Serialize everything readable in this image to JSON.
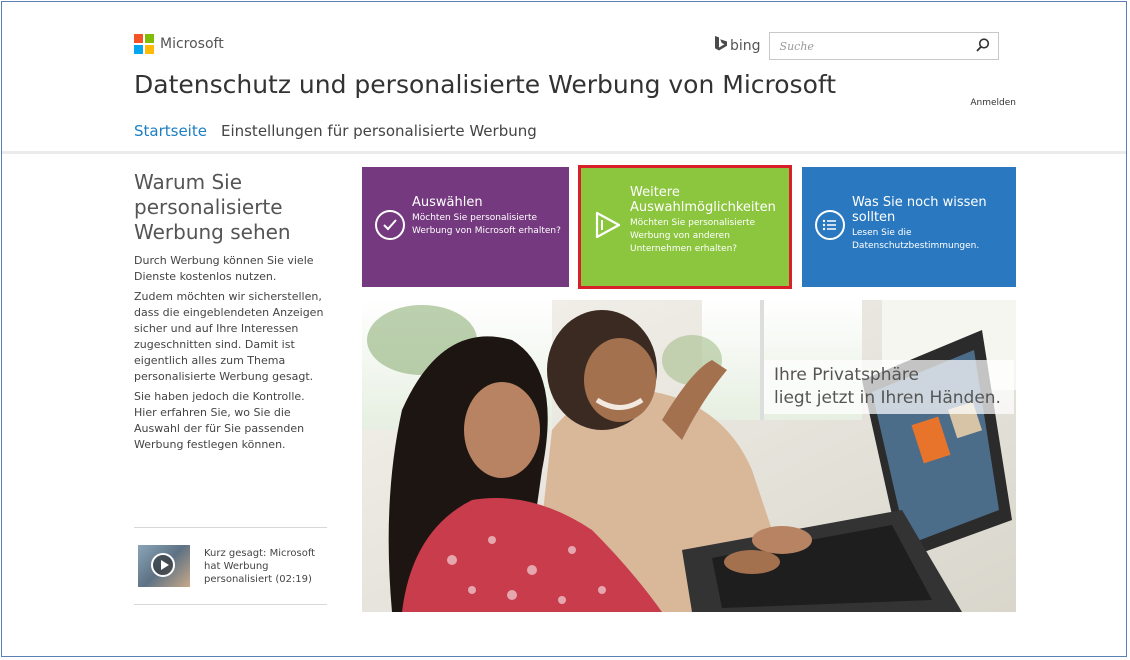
{
  "header": {
    "brand": "Microsoft",
    "bing_label": "bing",
    "search_placeholder": "Suche",
    "page_title": "Datenschutz und personalisierte Werbung von Microsoft",
    "signin": "Anmelden"
  },
  "nav": {
    "items": [
      "Startseite",
      "Einstellungen für personalisierte Werbung"
    ],
    "active_index": 0
  },
  "sidebar": {
    "heading": "Warum Sie personalisierte Werbung sehen",
    "paragraphs": [
      "Durch Werbung können Sie viele Dienste kostenlos nutzen.",
      "Zudem möchten wir sicherstellen, dass die eingeblendeten Anzeigen sicher und auf Ihre Interessen zugeschnitten sind. Damit ist eigentlich alles zum Thema personalisierte Werbung gesagt.",
      "Sie haben jedoch die Kontrolle. Hier erfahren Sie, wo Sie die Auswahl der für Sie passenden Werbung festlegen können."
    ],
    "video": {
      "label": "Kurz gesagt: Microsoft hat Werbung personalisiert (02:19)",
      "icon": "play-icon"
    }
  },
  "tiles": [
    {
      "title": "Auswählen",
      "subtitle": "Möchten Sie personalisierte Werbung von Microsoft erhalten?",
      "icon": "checkmark-icon",
      "color": "#74397e"
    },
    {
      "title": "Weitere Auswahlmöglichkeiten",
      "subtitle": "Möchten Sie personalisierte Werbung von anderen Unternehmen erhalten?",
      "icon": "play-outline-icon",
      "color": "#8cc63f",
      "highlighted": true
    },
    {
      "title": "Was Sie noch wissen sollten",
      "subtitle": "Lesen Sie die Datenschutzbestimmungen.",
      "icon": "list-icon",
      "color": "#2a79c0"
    }
  ],
  "hero": {
    "caption_line1": "Ihre Privatsphäre",
    "caption_line2": "liegt jetzt in Ihren Händen."
  },
  "colors": {
    "accent": "#1d7fc2",
    "highlight_border": "#d8202a"
  }
}
